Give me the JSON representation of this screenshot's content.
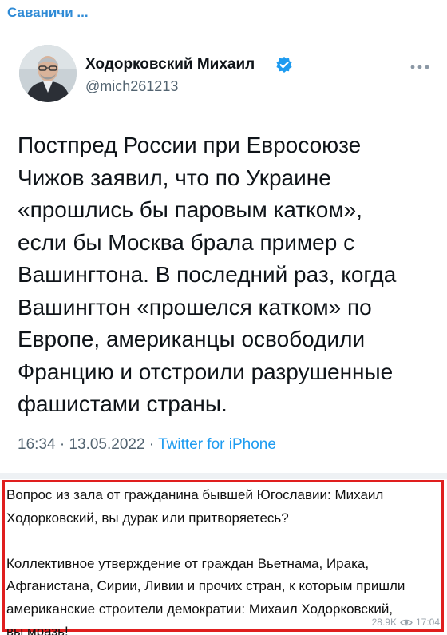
{
  "header": {
    "channel_title": "Саваничи ..."
  },
  "tweet": {
    "author_name": "Ходорковский Михаил",
    "author_handle": "@mich261213",
    "verified": true,
    "text": "Постпред России при Евросоюзе\nЧижов заявил, что по Украине\n«прошлись бы паровым катком»,\nесли бы Москва брала пример с\nВашингтона. В последний раз, когда\nВашингтон «прошелся катком» по\nЕвропе, американцы освободили\nФранцию и отстроили разрушенные\nфашистами страны.",
    "time": "16:34",
    "separator": " · ",
    "date": "13.05.2022",
    "source": "Twitter for iPhone",
    "icons": {
      "verified": "verified-badge-icon",
      "more": "more-options-icon"
    },
    "colors": {
      "verified": "#1d9bf0",
      "source_link": "#1d9bf0"
    }
  },
  "message": {
    "text": "Вопрос из зала от гражданина бывшей Югославии: Михаил\nХодорковский, вы дурак или притворяетесь?\n\nКоллективное утверждение от граждан Вьетнама, Ирака,\nАфганистана, Сирии, Ливии и прочих стран, к которым пришли\nамериканские строители демократии: Михаил Ходорковский,\nвы мразь!",
    "views": "28.9K",
    "time": "17:04",
    "highlight_color": "#e01e1e"
  }
}
